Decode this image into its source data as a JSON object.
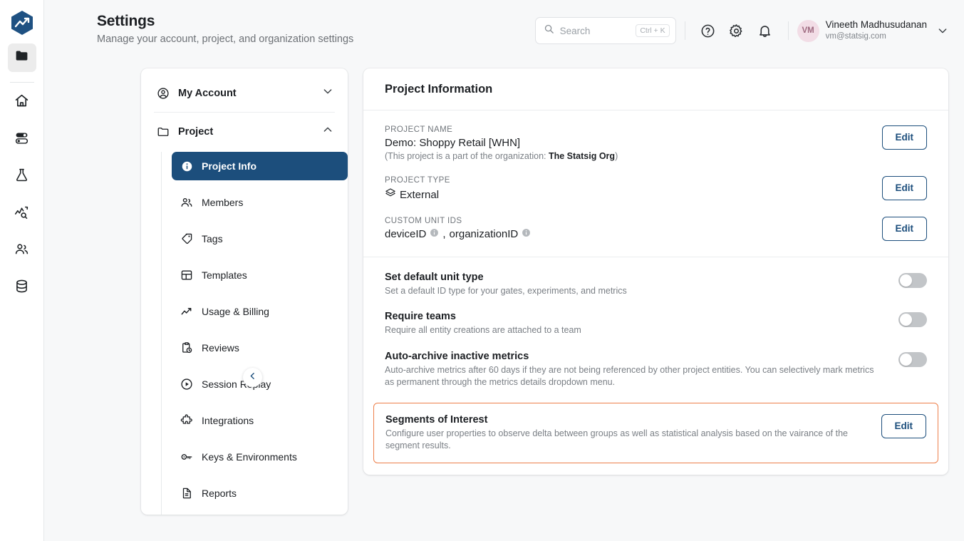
{
  "brand": {
    "logo_icon": "statsig-hex-logo",
    "accent_navy": "#1c4e7c",
    "highlight_orange": "#ed7f4a"
  },
  "rail": {
    "items": [
      {
        "icon": "folder-icon",
        "name": "projects",
        "active": true
      },
      {
        "icon": "home-icon",
        "name": "home",
        "active": false
      },
      {
        "icon": "feature-gates-toggle-icon",
        "name": "feature-gates",
        "active": false
      },
      {
        "icon": "flask-experiments-icon",
        "name": "experiments",
        "active": false
      },
      {
        "icon": "metrics-chart-icon",
        "name": "metrics",
        "active": false
      },
      {
        "icon": "people-icon",
        "name": "audiences",
        "active": false
      },
      {
        "icon": "database-icon",
        "name": "data",
        "active": false
      }
    ]
  },
  "header": {
    "title": "Settings",
    "subtitle": "Manage your account, project, and organization settings",
    "search": {
      "placeholder": "Search",
      "shortcut": "Ctrl + K",
      "icon": "search-icon"
    },
    "help_icon": "help-circle-icon",
    "settings_icon": "gear-icon",
    "notifications_icon": "bell-icon",
    "user": {
      "initials": "VM",
      "name": "Vineeth Madhusudanan",
      "email": "vm@statsig.com",
      "chevron": "chevron-down-icon"
    }
  },
  "nav": {
    "my_account": {
      "label": "My Account",
      "icon": "user-circle-icon",
      "chevron": "chevron-down-icon"
    },
    "project": {
      "label": "Project",
      "icon": "folder-icon",
      "chevron": "chevron-up-icon"
    },
    "items": [
      {
        "label": "Project Info",
        "icon": "info-circle-icon",
        "selected": true
      },
      {
        "label": "Members",
        "icon": "people-icon",
        "selected": false
      },
      {
        "label": "Tags",
        "icon": "tag-icon",
        "selected": false
      },
      {
        "label": "Templates",
        "icon": "layout-template-icon",
        "selected": false
      },
      {
        "label": "Usage & Billing",
        "icon": "trending-up-icon",
        "selected": false
      },
      {
        "label": "Reviews",
        "icon": "clipboard-clock-icon",
        "selected": false
      },
      {
        "label": "Session Replay",
        "icon": "play-circle-icon",
        "selected": false
      },
      {
        "label": "Integrations",
        "icon": "puzzle-piece-icon",
        "selected": false
      },
      {
        "label": "Keys & Environments",
        "icon": "key-icon",
        "selected": false
      },
      {
        "label": "Reports",
        "icon": "document-icon",
        "selected": false
      }
    ],
    "collapse_icon": "chevron-left-icon"
  },
  "content": {
    "card_title": "Project Information",
    "edit_label": "Edit",
    "fields": [
      {
        "kicker": "PROJECT NAME",
        "value": "Demo: Shoppy Retail [WHN]",
        "note_prefix": "(This project is a part of the organization: ",
        "note_bold": "The Statsig Org",
        "note_suffix": ")"
      },
      {
        "kicker": "PROJECT TYPE",
        "value": "External",
        "value_icon": "layers-icon"
      },
      {
        "kicker": "CUSTOM UNIT IDS",
        "unit_ids": [
          "deviceID",
          "organizationID"
        ],
        "separator": ", ",
        "info_icon": "info-filled-icon"
      }
    ],
    "toggles": [
      {
        "title": "Set default unit type",
        "desc": "Set a default ID type for your gates, experiments, and metrics",
        "on": false
      },
      {
        "title": "Require teams",
        "desc": "Require all entity creations are attached to a team",
        "on": false
      },
      {
        "title": "Auto-archive inactive metrics",
        "desc": "Auto-archive metrics after 60 days if they are not being referenced by other project entities. You can selectively mark metrics as permanent through the metrics details dropdown menu.",
        "on": false
      }
    ],
    "highlight": {
      "title": "Segments of Interest",
      "desc": "Configure user properties to observe delta between groups as well as statistical analysis based on the vairance of the segment results.",
      "edit_label": "Edit"
    }
  }
}
